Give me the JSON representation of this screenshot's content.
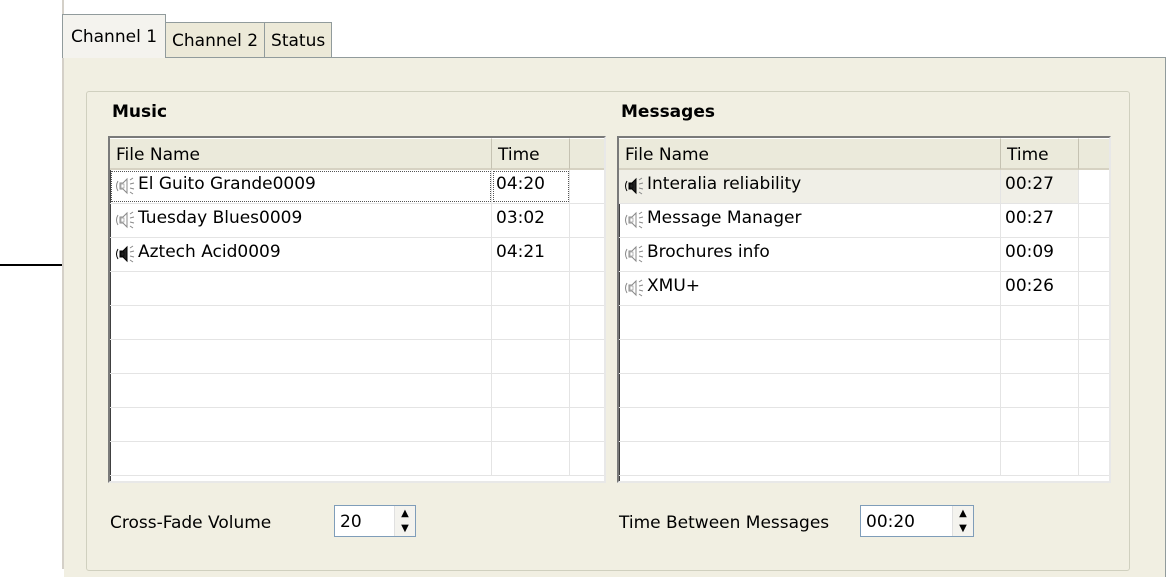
{
  "tabs": [
    "Channel 1",
    "Channel 2",
    "Status"
  ],
  "active_tab": "Channel 1",
  "music": {
    "title": "Music",
    "columns": [
      "File Name",
      "Time"
    ],
    "rows": [
      {
        "name": "El Guito Grande0009",
        "time": "04:20",
        "state": "idle"
      },
      {
        "name": "Tuesday Blues0009",
        "time": "03:02",
        "state": "idle"
      },
      {
        "name": "Aztech Acid0009",
        "time": "04:21",
        "state": "playing"
      }
    ]
  },
  "messages": {
    "title": "Messages",
    "columns": [
      "File Name",
      "Time"
    ],
    "rows": [
      {
        "name": "Interalia reliability",
        "time": "00:27",
        "state": "playing"
      },
      {
        "name": "Message Manager",
        "time": "00:27",
        "state": "idle"
      },
      {
        "name": "Brochures info",
        "time": "00:09",
        "state": "idle"
      },
      {
        "name": "XMU+",
        "time": "00:26",
        "state": "idle"
      }
    ]
  },
  "cross_fade": {
    "label": "Cross-Fade Volume",
    "value": "20"
  },
  "time_between": {
    "label": "Time Between Messages",
    "value": "00:20"
  },
  "icons": {
    "idle": "speaker-idle-icon",
    "playing": "speaker-playing-icon",
    "spin_up": "spin-up-icon",
    "spin_down": "spin-down-icon"
  }
}
